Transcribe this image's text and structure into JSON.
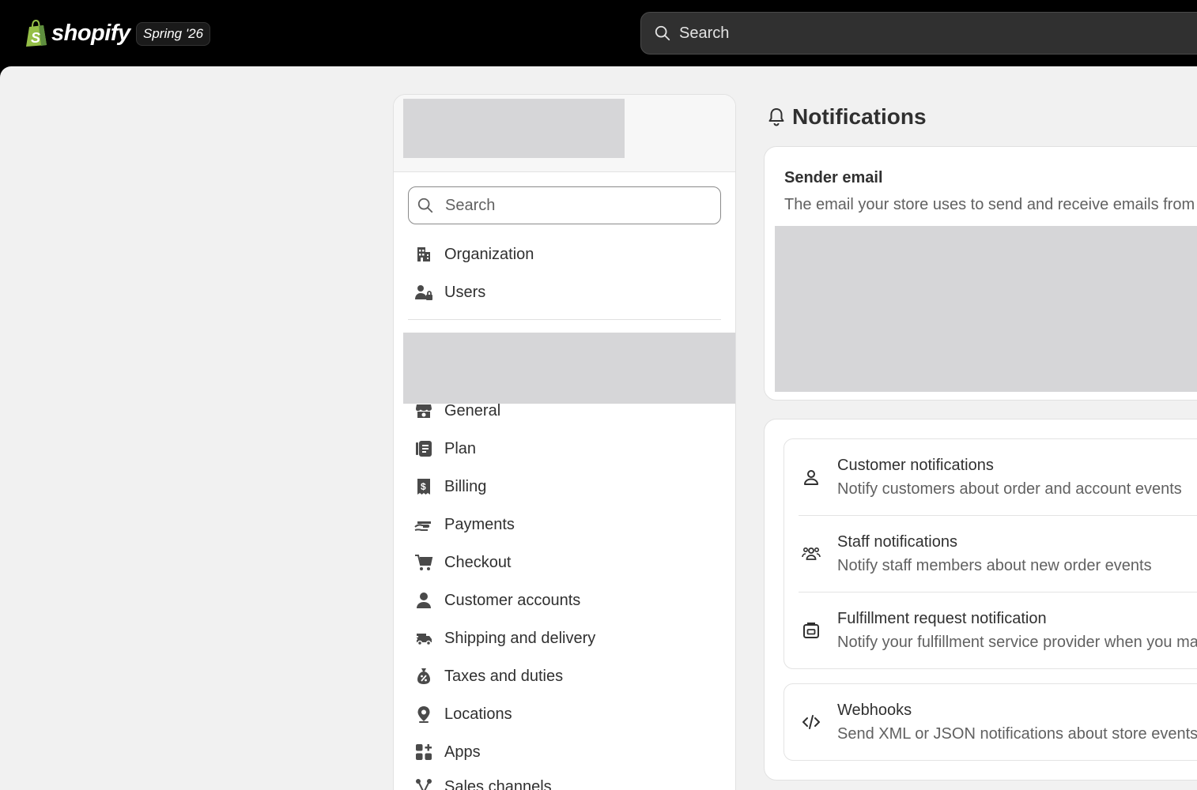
{
  "topbar": {
    "brand": "shopify",
    "version": "Spring '26",
    "search_placeholder": "Search"
  },
  "sidebar": {
    "search_placeholder": "Search",
    "top_items": [
      {
        "label": "Organization",
        "icon": "building-icon"
      },
      {
        "label": "Users",
        "icon": "users-lock-icon"
      }
    ],
    "store_items": [
      {
        "label": "General",
        "icon": "store-icon"
      },
      {
        "label": "Plan",
        "icon": "plan-icon"
      },
      {
        "label": "Billing",
        "icon": "billing-receipt-icon"
      },
      {
        "label": "Payments",
        "icon": "payments-hand-icon"
      },
      {
        "label": "Checkout",
        "icon": "cart-icon"
      },
      {
        "label": "Customer accounts",
        "icon": "person-icon"
      },
      {
        "label": "Shipping and delivery",
        "icon": "truck-icon"
      },
      {
        "label": "Taxes and duties",
        "icon": "tax-bag-icon"
      },
      {
        "label": "Locations",
        "icon": "location-pin-icon"
      },
      {
        "label": "Apps",
        "icon": "apps-grid-icon"
      },
      {
        "label": "Sales channels",
        "icon": "sales-channels-icon"
      }
    ]
  },
  "page": {
    "title": "Notifications",
    "sender": {
      "title": "Sender email",
      "description": "The email your store uses to send and receive emails from customers"
    },
    "notifications": [
      {
        "title": "Customer notifications",
        "description": "Notify customers about order and account events",
        "icon": "person-outline-icon"
      },
      {
        "title": "Staff notifications",
        "description": "Notify staff members about new order events",
        "icon": "group-icon"
      },
      {
        "title": "Fulfillment request notification",
        "description": "Notify your fulfillment service provider when you mark an order as fulfilled",
        "icon": "fulfillment-icon"
      }
    ],
    "webhooks": {
      "title": "Webhooks",
      "description": "Send XML or JSON notifications about store events to a URL",
      "icon": "code-icon"
    }
  },
  "colors": {
    "topbar_bg": "#000000",
    "surface": "#f1f1f1",
    "card": "#ffffff",
    "text": "#303030",
    "subdued_text": "#616161",
    "redaction": "#d6d6d8"
  }
}
